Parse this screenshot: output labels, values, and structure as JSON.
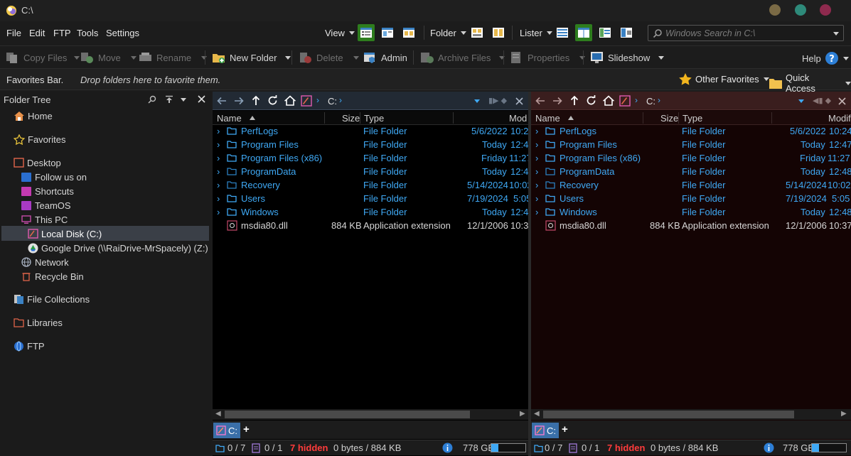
{
  "window": {
    "title": "C:\\"
  },
  "menu": {
    "file": "File",
    "edit": "Edit",
    "ftp": "FTP",
    "tools": "Tools",
    "settings": "Settings"
  },
  "viewgroups": {
    "view": "View",
    "folder": "Folder",
    "lister": "Lister"
  },
  "search": {
    "placeholder": "Windows Search in C:\\"
  },
  "toolbar": {
    "copy": "Copy Files",
    "move": "Move",
    "rename": "Rename",
    "new_folder": "New Folder",
    "delete": "Delete",
    "admin": "Admin",
    "archive": "Archive Files",
    "properties": "Properties",
    "slideshow": "Slideshow",
    "help": "Help"
  },
  "favbar": {
    "label": "Favorites Bar.",
    "hint": "Drop folders here to favorite them.",
    "other": "Other Favorites",
    "quick": "Quick Access"
  },
  "tree": {
    "title": "Folder Tree",
    "items": [
      "Home",
      "Favorites",
      "Desktop",
      "Follow us on",
      "Shortcuts",
      "TeamOS",
      "This PC",
      "Local Disk (C:)",
      "Google Drive (\\\\RaiDrive-MrSpacely) (Z:)",
      "Network",
      "Recycle Bin",
      "File Collections",
      "Libraries",
      "FTP"
    ]
  },
  "lister": {
    "path": "C:",
    "columns": {
      "name": "Name",
      "size": "Size",
      "type": "Type",
      "modified_left": "Mod",
      "modified_right": "Modifi"
    },
    "files": [
      {
        "name": "PerfLogs",
        "size": "",
        "type": "File Folder",
        "date": "5/6/2022",
        "time": "10:24"
      },
      {
        "name": "Program Files",
        "size": "",
        "type": "File Folder",
        "date": "Today",
        "time": "12:47"
      },
      {
        "name": "Program Files (x86)",
        "size": "",
        "type": "File Folder",
        "date": "Friday",
        "time": "11:27"
      },
      {
        "name": "ProgramData",
        "size": "",
        "type": "File Folder",
        "date": "Today",
        "time": "12:48"
      },
      {
        "name": "Recovery",
        "size": "",
        "type": "File Folder",
        "date": "5/14/2024",
        "time": "10:02"
      },
      {
        "name": "Users",
        "size": "",
        "type": "File Folder",
        "date": "7/19/2024",
        "time": "5:05"
      },
      {
        "name": "Windows",
        "size": "",
        "type": "File Folder",
        "date": "Today",
        "time": "12:48"
      },
      {
        "name": "msdia80.dll",
        "size": "884 KB",
        "type": "Application extension",
        "date": "12/1/2006",
        "time": "10:37"
      }
    ],
    "tab": "C:",
    "tab_add": "+"
  },
  "status": {
    "folders": "0 / 7",
    "files": "0 / 1",
    "hidden": "7 hidden",
    "bytes": "0 bytes / 884 KB",
    "free": "778 GB",
    "free_fraction": 0.2
  },
  "colors": {
    "accent_blue": "#3fa9f5",
    "left_lister_bg": "#000000",
    "right_lister_bg": "#140404",
    "hidden_red": "#ff3b3b",
    "view_selected": "#2e7d1e"
  }
}
